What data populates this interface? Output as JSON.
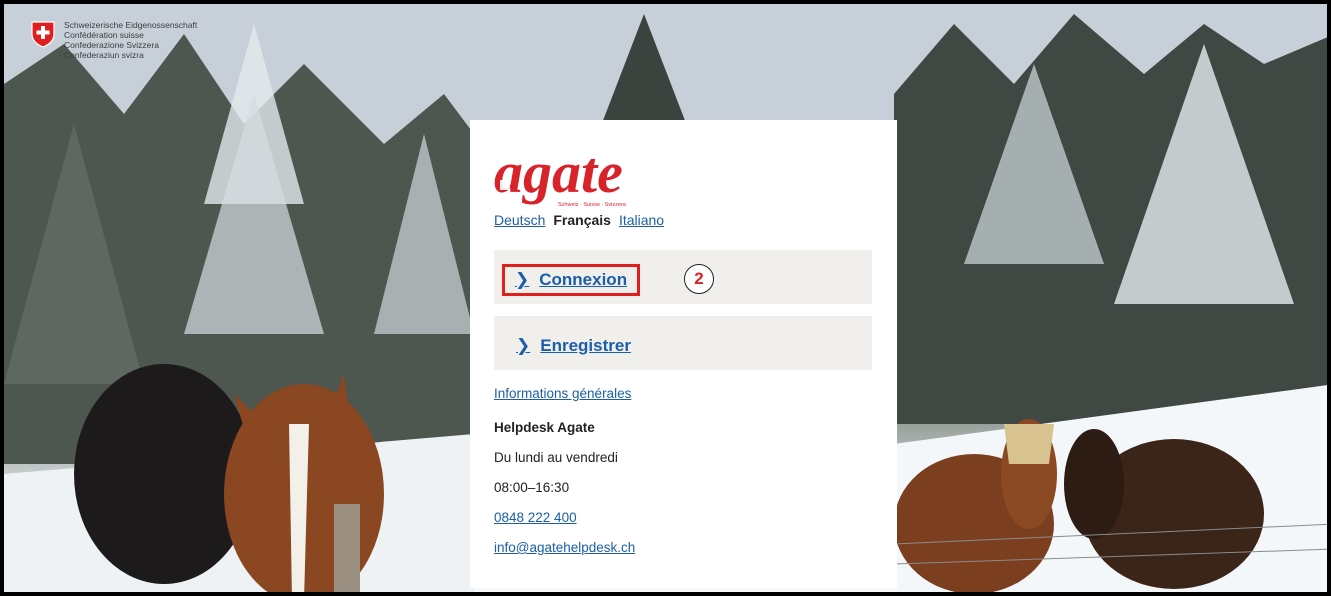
{
  "federation": {
    "lines": [
      "Schweizerische Eidgenossenschaft",
      "Confédération suisse",
      "Confederazione Svizzera",
      "Confederaziun svizra"
    ],
    "emblem": "swiss-cross-shield-icon"
  },
  "logo": {
    "text": "agate",
    "tagline": "Schweiz · Suisse · Svizzera",
    "color": "#d8232a"
  },
  "languages": {
    "de": "Deutsch",
    "fr": "Français",
    "it": "Italiano",
    "current": "fr"
  },
  "actions": {
    "login_label": "Connexion",
    "register_label": "Enregistrer",
    "step_badge": "2"
  },
  "info": {
    "general_link": "Informations générales",
    "helpdesk_title": "Helpdesk Agate",
    "days": "Du lundi au vendredi",
    "hours": "08:00–16:30",
    "phone": "0848 222 400",
    "email": "info@agatehelpdesk.ch"
  },
  "colors": {
    "link": "#1a5fa8",
    "highlight": "#e02020",
    "panel": "#f1efec"
  }
}
